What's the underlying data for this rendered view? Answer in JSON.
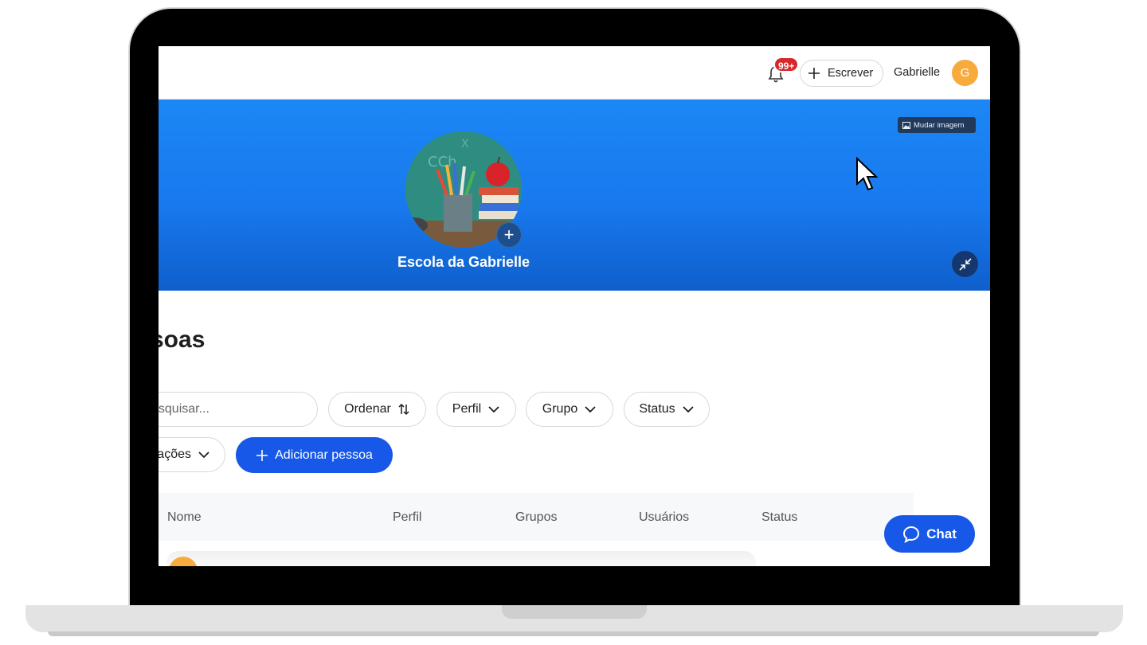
{
  "topbar": {
    "notification_count": "99+",
    "write_label": "Escrever",
    "user_name": "Gabrielle",
    "avatar_initial": "G"
  },
  "banner": {
    "change_image_label": "Mudar imagem",
    "school_name": "Escola da Gabrielle"
  },
  "page": {
    "title": "soas"
  },
  "filters": {
    "search_placeholder": "esquisar...",
    "sort_label": "Ordenar",
    "profile_label": "Perfil",
    "group_label": "Grupo",
    "status_label": "Status",
    "actions_label": "ações",
    "add_person_label": "Adicionar pessoa"
  },
  "table": {
    "columns": [
      "Nome",
      "Perfil",
      "Grupos",
      "Usuários",
      "Status"
    ]
  },
  "chat": {
    "label": "Chat"
  },
  "colors": {
    "primary": "#1758e8",
    "banner": "#1c87f5",
    "badge": "#d8262b",
    "avatar": "#f6ab3c"
  }
}
